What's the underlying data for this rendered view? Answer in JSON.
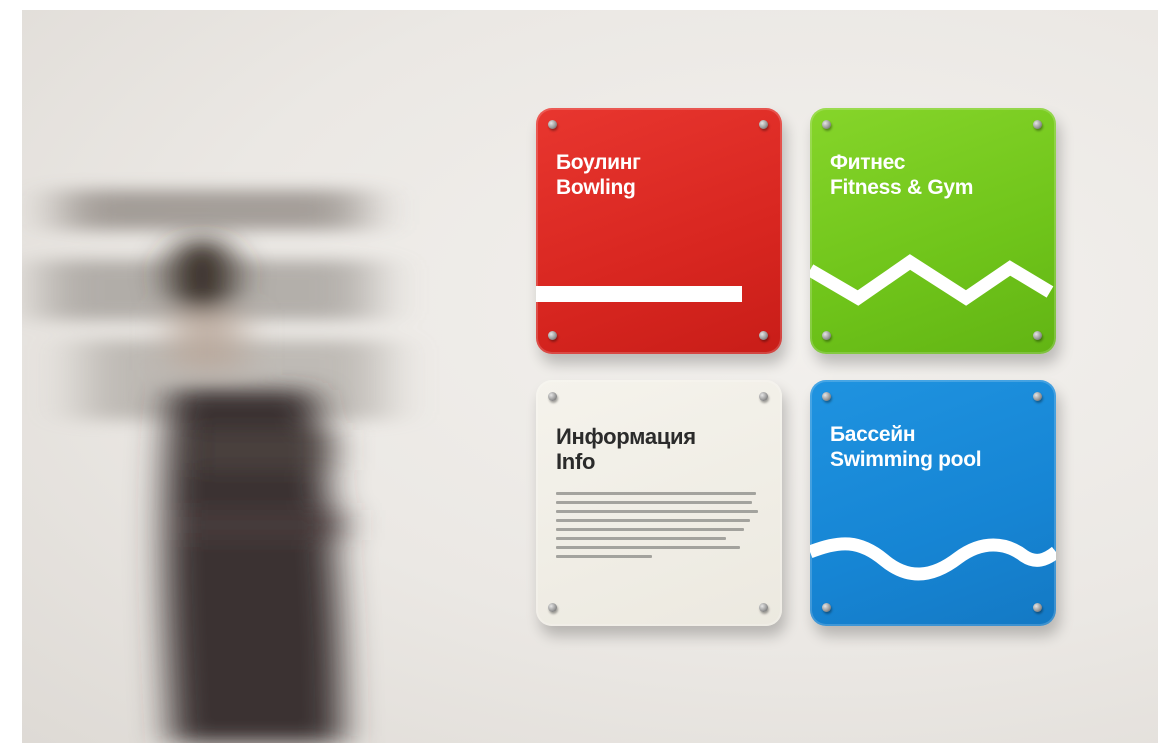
{
  "signs": {
    "bowling": {
      "line1": "Боулинг",
      "line2": "Bowling",
      "color": "#d82620"
    },
    "fitness": {
      "line1": "Фитнес",
      "line2": "Fitness & Gym",
      "color": "#6fc41a"
    },
    "info": {
      "line1": "Информация",
      "line2": "Info",
      "color": "#f0eee6"
    },
    "pool": {
      "line1": "Бассейн",
      "line2": "Swimming pool",
      "color": "#1685d4"
    }
  },
  "scene": {
    "wall_color": "#ebe8e4",
    "person": "blurred-walking-person"
  }
}
